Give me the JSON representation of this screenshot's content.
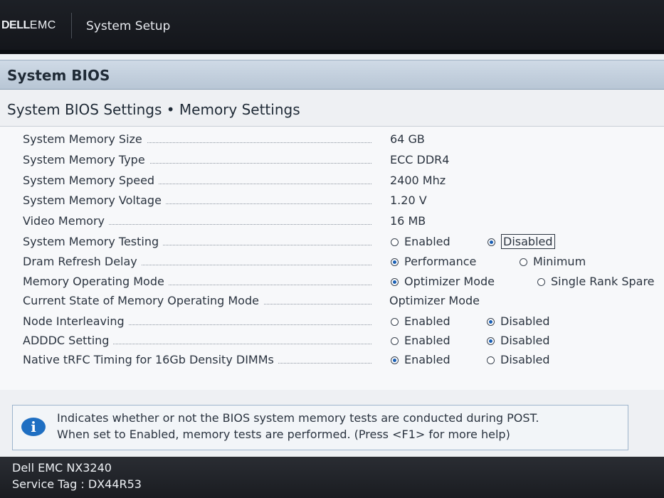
{
  "header": {
    "brand_dell": "DELL",
    "brand_emc": "EMC",
    "title": "System Setup"
  },
  "section": {
    "title": "System BIOS"
  },
  "breadcrumb": "System BIOS Settings • Memory Settings",
  "settings": [
    {
      "label": "System Memory Size",
      "value": "64 GB"
    },
    {
      "label": "System Memory Type",
      "value": "ECC DDR4"
    },
    {
      "label": "System Memory Speed",
      "value": "2400 Mhz"
    },
    {
      "label": "System Memory Voltage",
      "value": "1.20 V"
    },
    {
      "label": "Video Memory",
      "value": "16 MB"
    },
    {
      "label": "System Memory Testing",
      "options": [
        "Enabled",
        "Disabled"
      ],
      "selected": "Disabled"
    },
    {
      "label": "Dram Refresh Delay",
      "options": [
        "Performance",
        "Minimum"
      ],
      "selected": "Performance"
    },
    {
      "label": "Memory Operating Mode",
      "options": [
        "Optimizer Mode",
        "Single Rank Spare"
      ],
      "selected": "Optimizer Mode"
    },
    {
      "label": "Current State of Memory Operating Mode",
      "value": "Optimizer Mode"
    },
    {
      "label": "Node Interleaving",
      "options": [
        "Enabled",
        "Disabled"
      ],
      "selected": "Disabled"
    },
    {
      "label": "ADDDC Setting",
      "options": [
        "Enabled",
        "Disabled"
      ],
      "selected": "Disabled"
    },
    {
      "label": "Native tRFC Timing for 16Gb Density DIMMs",
      "options": [
        "Enabled",
        "Disabled"
      ],
      "selected": "Enabled"
    }
  ],
  "help": {
    "icon": "info-icon",
    "line1": "Indicates whether or not the BIOS system memory tests are conducted during POST.",
    "line2": "When set to Enabled, memory tests are performed. (Press <F1> for more help)"
  },
  "footer": {
    "model": "Dell EMC NX3240",
    "service_tag": "Service Tag : DX44R53"
  }
}
